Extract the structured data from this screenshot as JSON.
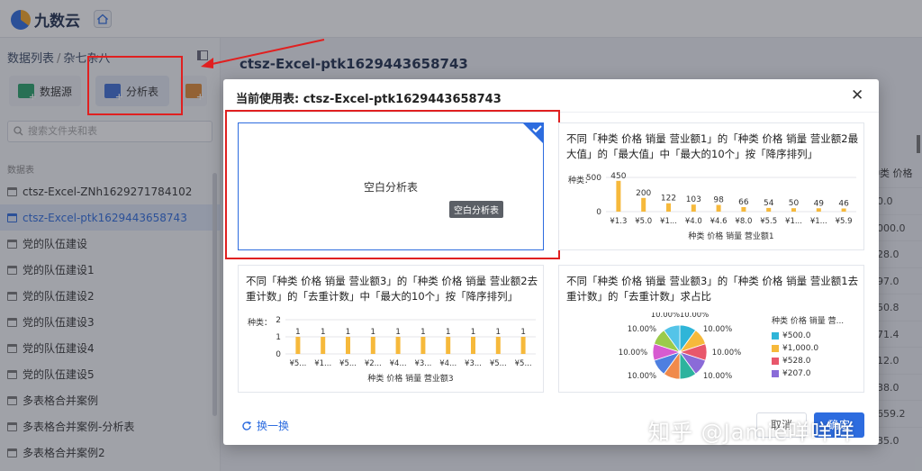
{
  "app": {
    "logo_text": "九数云"
  },
  "sidebar": {
    "breadcrumb": [
      "数据列表",
      "杂七杂八"
    ],
    "breadcrumb_sep": "/",
    "tools": [
      "数据源",
      "分析表"
    ],
    "search_placeholder": "搜索文件夹和表",
    "section_title": "数据表",
    "items": [
      "ctsz-Excel-ZNh1629271784102",
      "ctsz-Excel-ptk1629443658743",
      "党的队伍建设",
      "党的队伍建设1",
      "党的队伍建设2",
      "党的队伍建设3",
      "党的队伍建设4",
      "党的队伍建设5",
      "多表格合并案例",
      "多表格合并案例-分析表",
      "多表格合并案例2"
    ],
    "active_index": 1
  },
  "main": {
    "title": "ctsz-Excel-ptk1629443658743",
    "table_header": "种类 价格",
    "table_values": [
      "0.0",
      "000.0",
      "28.0",
      "97.0",
      "50.8",
      "71.4",
      "12.0",
      "38.0",
      "659.2",
      "35.0"
    ]
  },
  "modal": {
    "title": "当前使用表: ctsz-Excel-ptk1629443658743",
    "blank_card": {
      "label": "空白分析表",
      "tooltip": "空白分析表"
    },
    "card1": {
      "title": "不同「种类 价格 销量 营业额1」的「种类 价格 销量 营业额2最大值」的「最大值」中「最大的10个」按「降序排列」",
      "ylabel": "种类：",
      "xlabel": "种类 价格 销量 营业额1"
    },
    "card2": {
      "title": "不同「种类 价格 销量 营业额3」的「种类 价格 销量 营业额2去重计数」的「去重计数」中「最大的10个」按「降序排列」",
      "ylabel": "种类：",
      "xlabel": "种类 价格 销量 营业额3"
    },
    "card3": {
      "title": "不同「种类 价格 销量 营业额3」的「种类 价格 销量 营业额1去重计数」的「去重计数」求占比",
      "legend_title": "种类 价格 销量 营...",
      "legend": [
        "¥500.0",
        "¥1,000.0",
        "¥528.0",
        "¥207.0"
      ]
    },
    "refresh_label": "换一换",
    "cancel_label": "取消",
    "ok_label": "确定"
  },
  "watermark": "知乎 @Jamie咩咩咩",
  "colors": {
    "accent": "#2d6cdf",
    "bar": "#f6b93b",
    "annotation": "#e02020"
  },
  "chart_data": [
    {
      "type": "bar",
      "categories": [
        "¥1.3",
        "¥5.0",
        "¥1...",
        "¥4.0",
        "¥4.6",
        "¥8.0",
        "¥5.5",
        "¥1...",
        "¥1...",
        "¥5.9"
      ],
      "values": [
        450,
        200,
        122,
        103,
        98,
        66,
        54,
        50,
        49,
        46
      ],
      "yticks": [
        "500",
        "0"
      ],
      "ylim": [
        0,
        500
      ]
    },
    {
      "type": "bar",
      "categories": [
        "¥5...",
        "¥1...",
        "¥5...",
        "¥2...",
        "¥4...",
        "¥3...",
        "¥4...",
        "¥3...",
        "¥5...",
        "¥5..."
      ],
      "values": [
        1,
        1,
        1,
        1,
        1,
        1,
        1,
        1,
        1,
        1
      ],
      "yticks": [
        "2",
        "1",
        "0"
      ],
      "ylim": [
        0,
        2
      ]
    },
    {
      "type": "pie",
      "values": [
        10,
        10,
        10,
        10,
        10,
        10,
        10,
        10,
        10,
        10
      ],
      "labels": [
        "10.00%",
        "10.00%",
        "10.00%",
        "10.00%",
        "10.00%",
        "10.00%",
        "10.00%",
        "10.00%",
        "10.00%",
        "10.00%"
      ],
      "colors": [
        "#2fb5d8",
        "#f6b93b",
        "#e8576b",
        "#8a6bd8",
        "#2db39e",
        "#f08a4b",
        "#4e7fe0",
        "#d75bd0",
        "#9bcb4b",
        "#54c4e8"
      ]
    }
  ]
}
